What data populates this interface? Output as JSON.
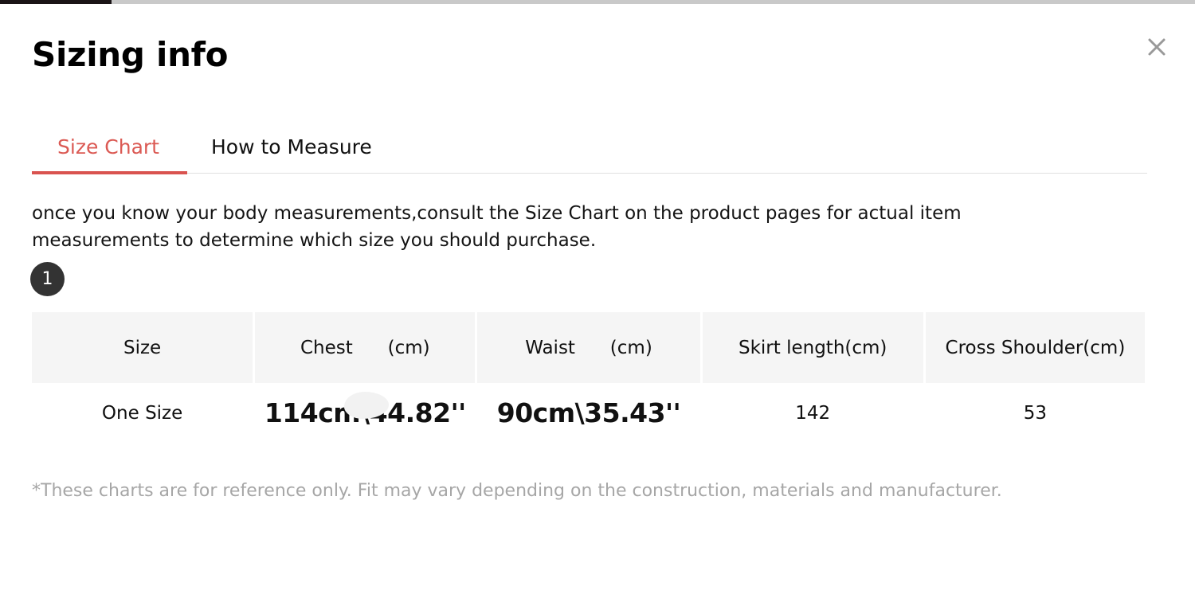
{
  "modal": {
    "title": "Sizing info",
    "close_label": "close-icon"
  },
  "tabs": [
    {
      "label": "Size Chart",
      "active": true
    },
    {
      "label": "How to Measure",
      "active": false
    }
  ],
  "intro": "once you know your body measurements,consult the Size Chart on the product pages for actual item measurements to determine which size you should purchase.",
  "step_badge": "1",
  "table": {
    "headers": [
      "Size",
      "Chest      (cm)",
      "Waist      (cm)",
      "Skirt length(cm)",
      "Cross Shoulder(cm)"
    ],
    "rows": [
      [
        "One Size",
        "114cm\\44.82''",
        "90cm\\35.43''",
        "142",
        "53"
      ]
    ]
  },
  "footnote": "*These charts are for reference only. Fit may vary depending on the construction, materials and manufacturer.",
  "colors": {
    "accent": "#d9534f",
    "tab_active_text": "#db5a54",
    "header_cell_bg": "#f5f5f5",
    "badge_bg": "#333333",
    "footnote_text": "#a6a6a6",
    "close_icon": "#999999"
  }
}
